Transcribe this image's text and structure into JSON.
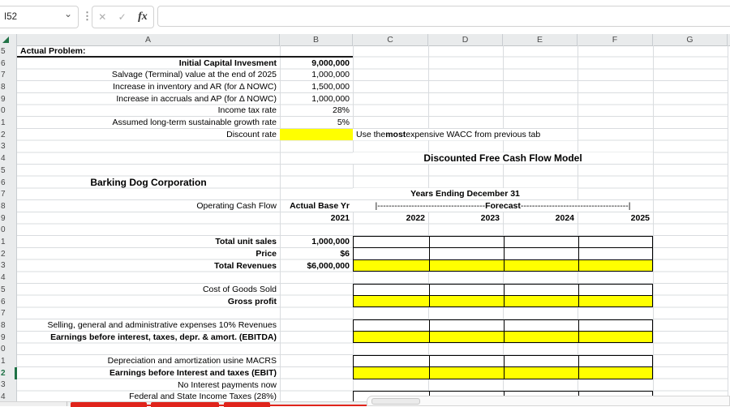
{
  "formula_bar": {
    "name_box_value": "I52",
    "cancel_icon": "✕",
    "confirm_icon": "✓",
    "fx_label": "fx",
    "formula_value": ""
  },
  "column_headers": [
    "A",
    "B",
    "C",
    "D",
    "E",
    "F",
    "G"
  ],
  "colors": {
    "highlight_yellow": "#FFFF00",
    "active_row_green": "#1E7145",
    "sheet_tab_red": "#E0241B",
    "header_gray": "#E9EBEC"
  },
  "grid": {
    "rows": [
      {
        "n": 25,
        "digit": "5",
        "hline": 1,
        "cells": [
          {
            "col": "A",
            "text": "Actual Problem:",
            "b": 1,
            "align": "left"
          }
        ]
      },
      {
        "n": 26,
        "digit": "6",
        "cells": [
          {
            "col": "A",
            "text": "Initial Capital Invesment",
            "b": 1
          },
          {
            "col": "B",
            "text": "9,000,000",
            "b": 1
          }
        ]
      },
      {
        "n": 27,
        "digit": "7",
        "cells": [
          {
            "col": "A",
            "text": "Salvage (Terminal) value at the end of 2025"
          },
          {
            "col": "B",
            "text": "1,000,000"
          }
        ]
      },
      {
        "n": 28,
        "digit": "8",
        "cells": [
          {
            "col": "A",
            "text": "Increase in inventory and AR (for Δ NOWC)"
          },
          {
            "col": "B",
            "text": "1,500,000"
          }
        ]
      },
      {
        "n": 29,
        "digit": "9",
        "cells": [
          {
            "col": "A",
            "text": "Increase in accruals and AP (for Δ NOWC)"
          },
          {
            "col": "B",
            "text": "1,000,000"
          }
        ]
      },
      {
        "n": 30,
        "digit": "0",
        "cells": [
          {
            "col": "A",
            "text": "Income tax rate"
          },
          {
            "col": "B",
            "text": "28%"
          }
        ]
      },
      {
        "n": 31,
        "digit": "1",
        "cells": [
          {
            "col": "A",
            "text": "Assumed long-term sustainable growth rate"
          },
          {
            "col": "B",
            "text": "5%"
          }
        ]
      },
      {
        "n": 32,
        "digit": "2",
        "cells": [
          {
            "col": "A",
            "text": "Discount rate"
          },
          {
            "col": "B",
            "text": "",
            "fill": "yellow"
          },
          {
            "col": "CE",
            "type": "rich",
            "align": "left",
            "whitebg": 1,
            "parts": [
              {
                "t": "Use the "
              },
              {
                "t": "most",
                "b": 1
              },
              {
                "t": " expensive WACC from previous tab"
              }
            ]
          }
        ]
      },
      {
        "n": 33,
        "digit": "3",
        "cells": []
      },
      {
        "n": 34,
        "digit": "4",
        "cells": [
          {
            "col": "CF",
            "text": "Discounted Free Cash Flow Model",
            "b": 1,
            "align": "center",
            "whitebg": 1,
            "big": 1
          }
        ]
      },
      {
        "n": 35,
        "digit": "5",
        "cells": []
      },
      {
        "n": 36,
        "digit": "6",
        "cells": [
          {
            "col": "A",
            "text": "Barking Dog Corporation",
            "b": 1,
            "align": "center",
            "big": 1
          }
        ]
      },
      {
        "n": 37,
        "digit": "7",
        "cells": [
          {
            "col": "CE",
            "text": "Years Ending December 31",
            "b": 1,
            "align": "center",
            "whitebg": 1
          }
        ]
      },
      {
        "n": 38,
        "digit": "8",
        "cells": [
          {
            "col": "A",
            "text": "Operating Cash Flow"
          },
          {
            "col": "B",
            "text": "Actual Base Yr",
            "b": 1
          },
          {
            "col": "CF",
            "type": "rich",
            "align": "center",
            "whitebg": 1,
            "parts": [
              {
                "t": "|--------------------------------------"
              },
              {
                "t": "Forecast ",
                "b": 1
              },
              {
                "t": "--------------------------------------|"
              }
            ]
          }
        ]
      },
      {
        "n": 39,
        "digit": "9",
        "cells": [
          {
            "col": "B",
            "text": "2021",
            "b": 1
          },
          {
            "col": "C",
            "text": "2022",
            "b": 1
          },
          {
            "col": "D",
            "text": "2023",
            "b": 1
          },
          {
            "col": "E",
            "text": "2024",
            "b": 1
          },
          {
            "col": "F",
            "text": "2025",
            "b": 1
          }
        ]
      },
      {
        "n": 40,
        "digit": "0",
        "cells": []
      },
      {
        "n": 41,
        "digit": "1",
        "box": "top",
        "fill": "white",
        "cells": [
          {
            "col": "A",
            "text": "Total unit sales",
            "b": 1
          },
          {
            "col": "B",
            "text": "1,000,000",
            "b": 1
          }
        ]
      },
      {
        "n": 42,
        "digit": "2",
        "box": "mid",
        "fill": "white",
        "cells": [
          {
            "col": "A",
            "text": "Price",
            "b": 1
          },
          {
            "col": "B",
            "text": "$6",
            "b": 1
          }
        ]
      },
      {
        "n": 43,
        "digit": "3",
        "box": "mid",
        "fill": "yellow",
        "cells": [
          {
            "col": "A",
            "text": "Total Revenues",
            "b": 1
          },
          {
            "col": "B",
            "text": "$6,000,000",
            "b": 1
          }
        ]
      },
      {
        "n": 44,
        "digit": "4",
        "cells": []
      },
      {
        "n": 45,
        "digit": "5",
        "box": "top",
        "fill": "white",
        "cells": [
          {
            "col": "A",
            "text": "Cost of Goods Sold"
          }
        ]
      },
      {
        "n": 46,
        "digit": "6",
        "box": "mid",
        "fill": "yellow",
        "cells": [
          {
            "col": "A",
            "text": "Gross profit",
            "b": 1
          }
        ]
      },
      {
        "n": 47,
        "digit": "7",
        "cells": []
      },
      {
        "n": 48,
        "digit": "8",
        "box": "top",
        "fill": "white",
        "cells": [
          {
            "col": "A",
            "text": "Selling, general and administrative expenses 10% Revenues"
          }
        ]
      },
      {
        "n": 49,
        "digit": "9",
        "box": "mid",
        "fill": "yellow",
        "cells": [
          {
            "col": "A",
            "text": "Earnings before interest, taxes, depr. & amort. (EBITDA)",
            "b": 1
          }
        ]
      },
      {
        "n": 50,
        "digit": "0",
        "cells": []
      },
      {
        "n": 51,
        "digit": "1",
        "box": "top",
        "fill": "white",
        "cells": [
          {
            "col": "A",
            "text": "Depreciation and amortization usine MACRS"
          }
        ]
      },
      {
        "n": 52,
        "digit": "2",
        "box": "mid",
        "fill": "yellow",
        "active": 1,
        "cells": [
          {
            "col": "A",
            "text": "Earnings before Interest and taxes (EBIT)",
            "b": 1
          }
        ]
      },
      {
        "n": 53,
        "digit": "3",
        "cells": [
          {
            "col": "A",
            "text": "No Interest payments now"
          }
        ]
      },
      {
        "n": 54,
        "digit": "4",
        "box": "solo",
        "fill": "white",
        "cells": [
          {
            "col": "A",
            "text": "Federal and State Income Taxes (28%)"
          }
        ]
      }
    ]
  }
}
